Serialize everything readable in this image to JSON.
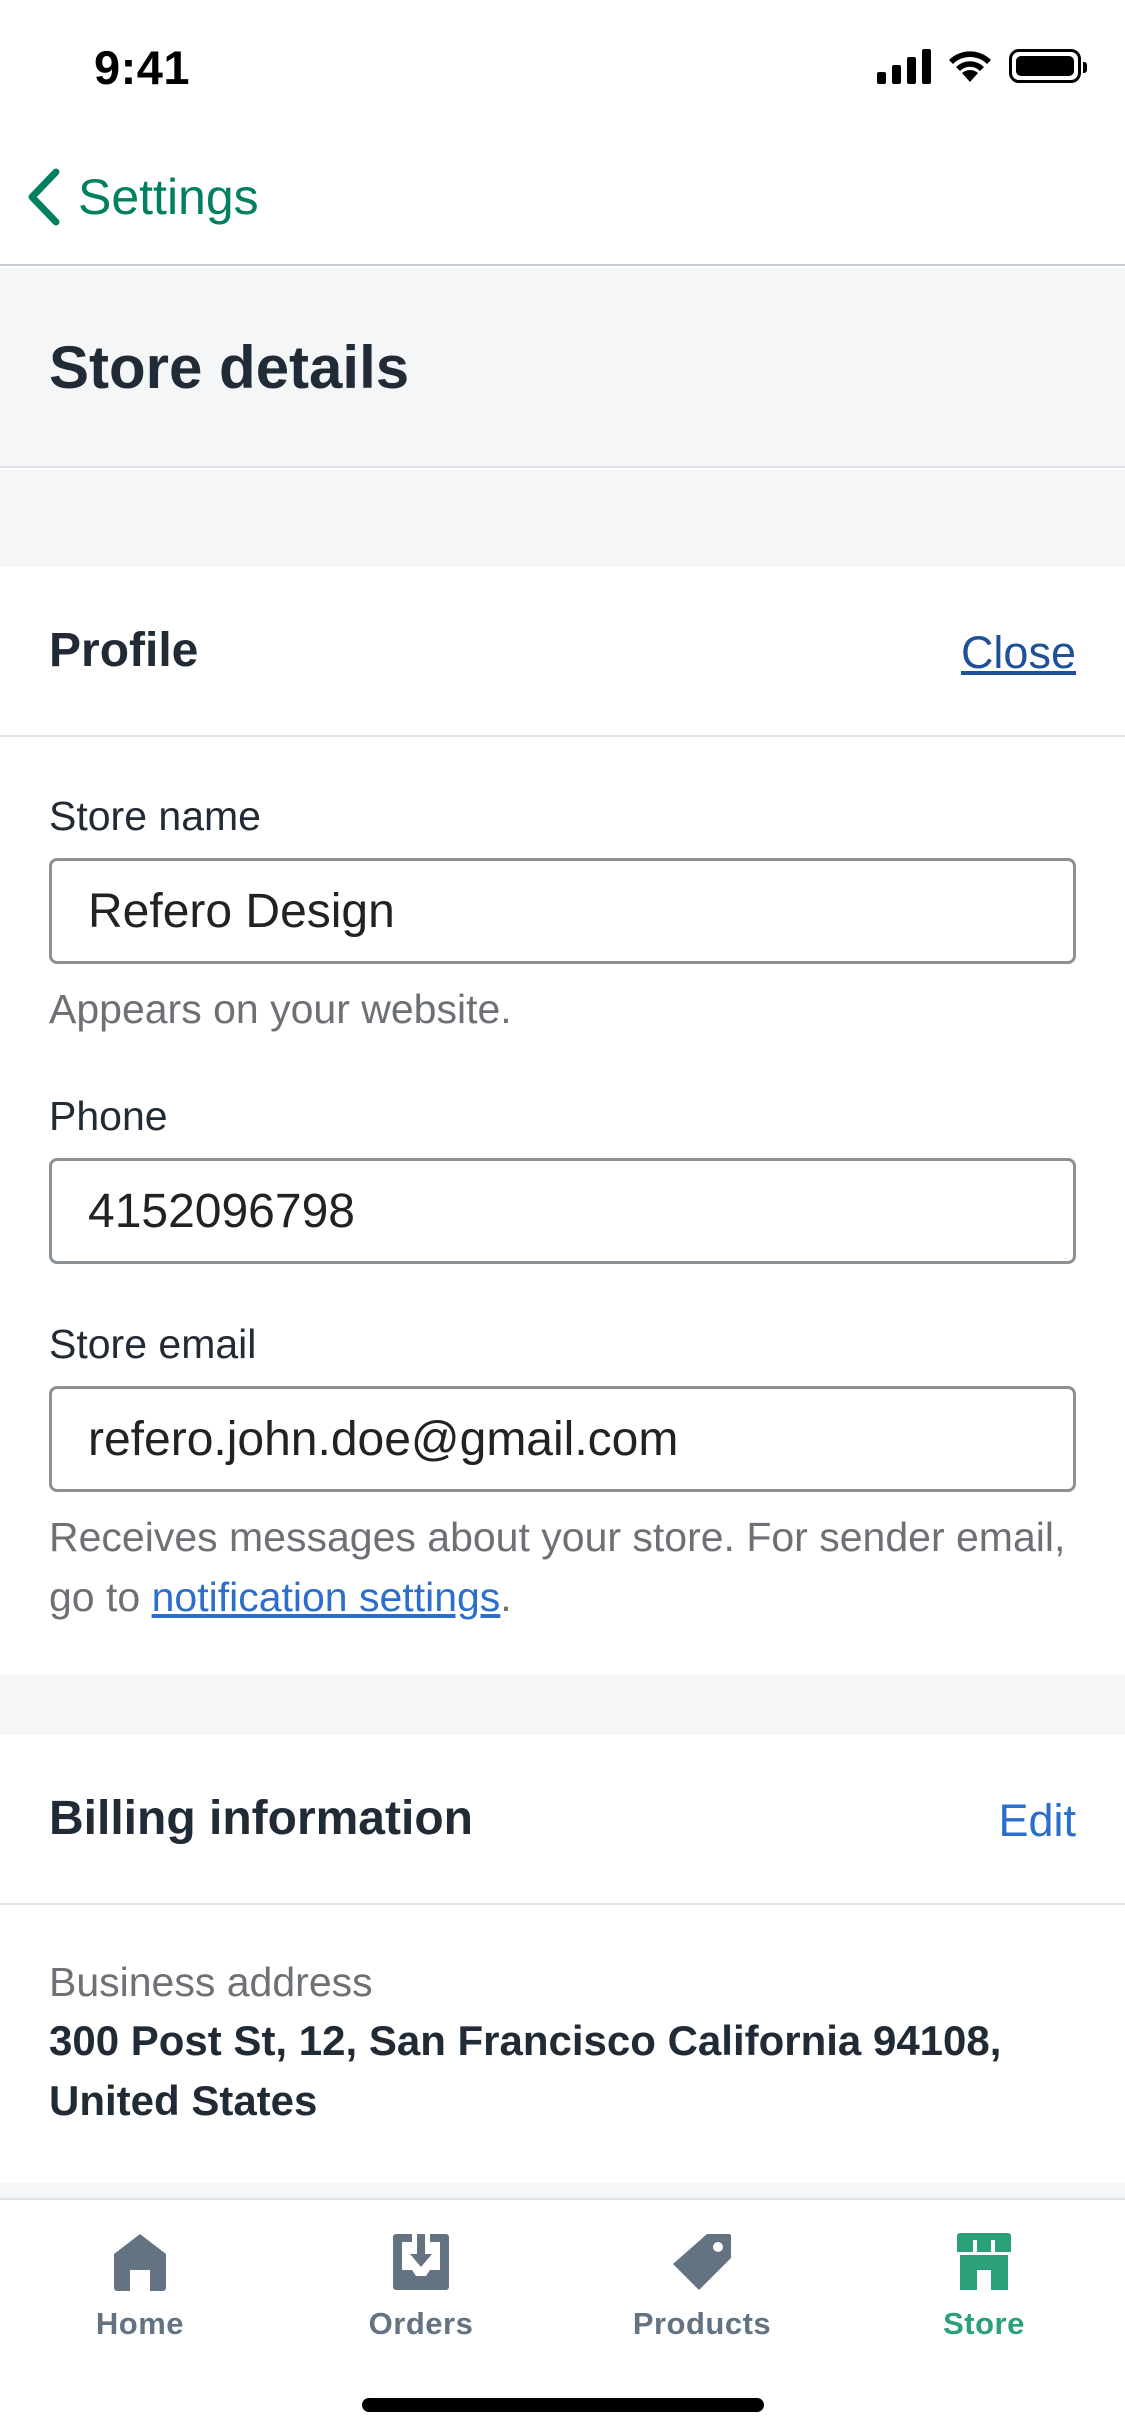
{
  "status_bar": {
    "time": "9:41"
  },
  "nav": {
    "back_label": "Settings"
  },
  "page": {
    "title": "Store details"
  },
  "profile": {
    "title": "Profile",
    "action": "Close",
    "store_name": {
      "label": "Store name",
      "value": "Refero Design",
      "help": "Appears on your website."
    },
    "phone": {
      "label": "Phone",
      "value": "4152096798"
    },
    "store_email": {
      "label": "Store email",
      "value": "refero.john.doe@gmail.com",
      "help_prefix": "Receives messages about your store. For sender email, go to ",
      "help_link": "notification settings",
      "help_suffix": "."
    }
  },
  "billing": {
    "title": "Billing information",
    "action": "Edit",
    "address_label": "Business address",
    "address_value": "300 Post St, 12, San Francisco California 94108, United States"
  },
  "tabs": [
    {
      "label": "Home",
      "icon": "home-icon",
      "active": false
    },
    {
      "label": "Orders",
      "icon": "orders-icon",
      "active": false
    },
    {
      "label": "Products",
      "icon": "tag-icon",
      "active": false
    },
    {
      "label": "Store",
      "icon": "store-icon",
      "active": true
    }
  ],
  "colors": {
    "accent": "#008060",
    "active_tab": "#2ba07a",
    "link": "#2c6ecb",
    "muted": "#637381"
  }
}
